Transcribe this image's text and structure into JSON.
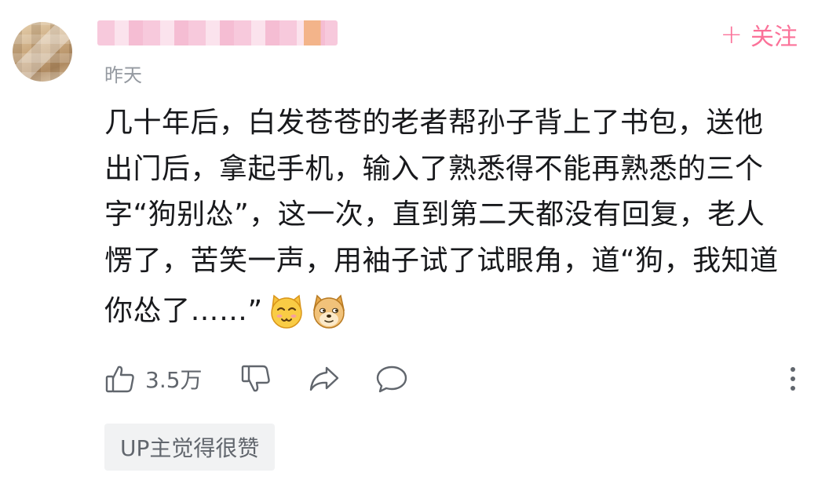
{
  "comment": {
    "follow_label": "关注",
    "time": "昨天",
    "lines": [
      "几十年后，白发苍苍的老者帮孙子背上了书包，送他",
      "出门后，拿起手机，输入了熟悉得不能再熟悉的三个",
      "字“狗别怂”，这一次，直到第二天都没有回复，老人",
      "愣了，苦笑一声，用袖子试了试眼角，道“狗，我知道",
      "你怂了……”"
    ],
    "emojis": [
      "cat-face-emoji",
      "doge-emoji"
    ],
    "actions": {
      "like_count": "3.5万",
      "like_icon": "thumb-up-icon",
      "dislike_icon": "thumb-down-icon",
      "share_icon": "share-icon",
      "reply_icon": "reply-bubble-icon",
      "more_icon": "more-vertical-icon"
    },
    "up_badge": "UP主觉得很赞"
  },
  "colors": {
    "accent": "#fb7299",
    "text": "#18191c",
    "muted": "#9499a0",
    "icon": "#61666d",
    "badge_bg": "#f1f2f3"
  }
}
